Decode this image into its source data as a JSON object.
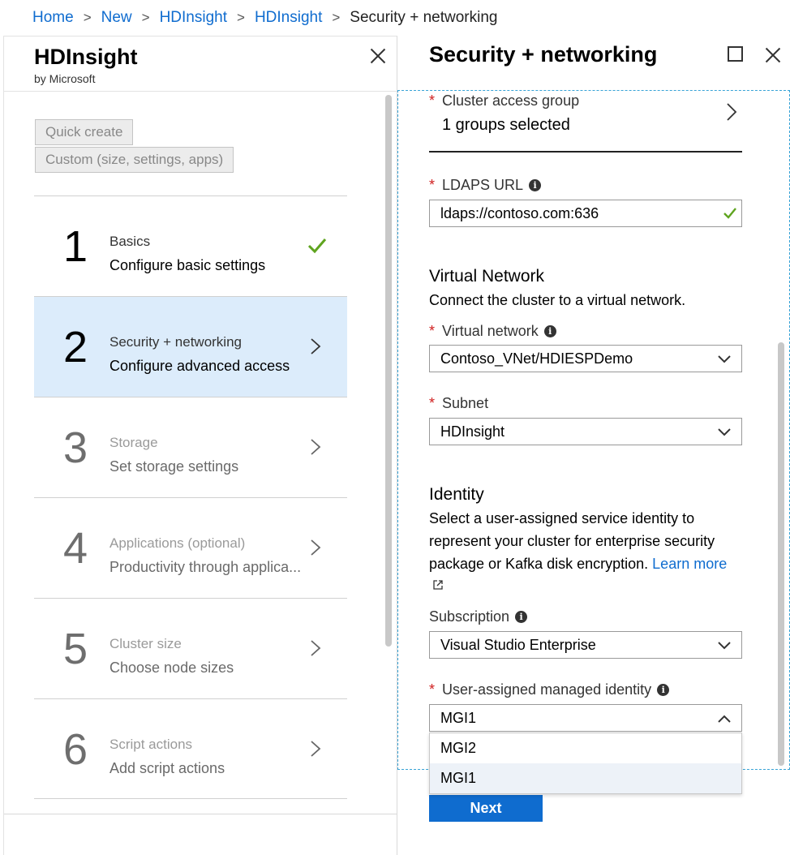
{
  "breadcrumb": {
    "items": [
      "Home",
      "New",
      "HDInsight",
      "HDInsight"
    ],
    "current": "Security + networking"
  },
  "left_blade": {
    "title": "HDInsight",
    "subtitle": "by Microsoft",
    "quick_create_label": "Quick create",
    "custom_label": "Custom (size, settings, apps)",
    "steps": [
      {
        "number": "1",
        "title": "Basics",
        "description": "Configure basic settings",
        "status": "complete"
      },
      {
        "number": "2",
        "title": "Security + networking",
        "description": "Configure advanced access",
        "status": "active"
      },
      {
        "number": "3",
        "title": "Storage",
        "description": "Set storage settings",
        "status": "pending"
      },
      {
        "number": "4",
        "title": "Applications (optional)",
        "description": "Productivity through applica...",
        "status": "pending"
      },
      {
        "number": "5",
        "title": "Cluster size",
        "description": "Choose node sizes",
        "status": "pending"
      },
      {
        "number": "6",
        "title": "Script actions",
        "description": "Add script actions",
        "status": "pending"
      }
    ]
  },
  "right_blade": {
    "title": "Security + networking",
    "cluster_access_group": {
      "label": "Cluster access group",
      "value": "1 groups selected"
    },
    "ldaps": {
      "label": "LDAPS URL",
      "value": "ldaps://contoso.com:636"
    },
    "virtual_network_section": {
      "title": "Virtual Network",
      "description": "Connect the cluster to a virtual network.",
      "vnet_label": "Virtual network",
      "vnet_value": "Contoso_VNet/HDIESPDemo",
      "subnet_label": "Subnet",
      "subnet_value": "HDInsight"
    },
    "identity_section": {
      "title": "Identity",
      "description": "Select a user-assigned service identity to represent your cluster for enterprise security package or Kafka disk encryption.",
      "learn_more": "Learn more",
      "subscription_label": "Subscription",
      "subscription_value": "Visual Studio Enterprise",
      "managed_identity_label": "User-assigned managed identity",
      "managed_identity_value": "MGI1",
      "options": [
        "MGI2",
        "MGI1"
      ]
    },
    "next_label": "Next"
  },
  "colors": {
    "accent": "#0f6ccf",
    "active_step_bg": "#dcecfb",
    "check_green": "#5fa41f",
    "required_red": "#d02020"
  }
}
